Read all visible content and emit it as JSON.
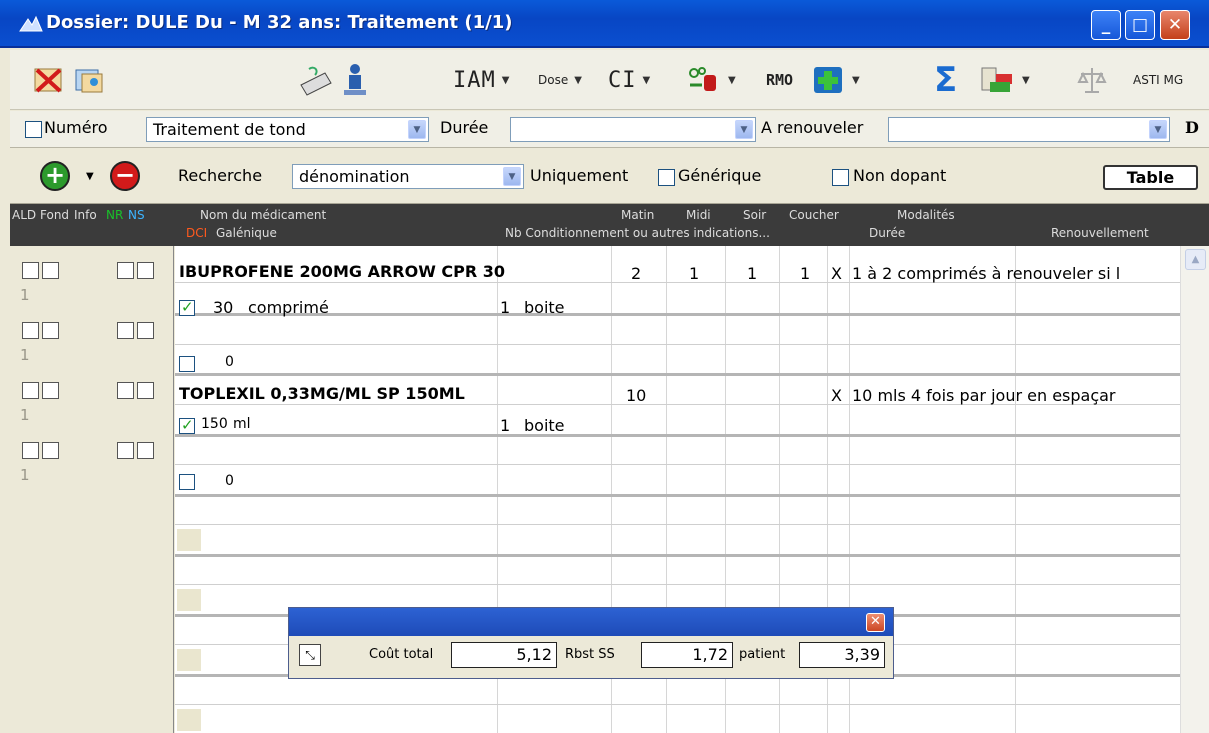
{
  "window": {
    "title": "Dossier: DULE Du - M 32 ans: Traitement  (1/1)"
  },
  "toolbar": {
    "iam_label": "IAM",
    "dose_label": "Dose",
    "ci_label": "CI",
    "rmo_label": "RMO",
    "asti_label": "ASTI MG"
  },
  "filters": {
    "numero_label": "Numéro",
    "treatment_value": "Traitement de tond",
    "duree_label": "Durée",
    "duree_value": "",
    "renouveler_label": "A renouveler",
    "renouveler_value": "",
    "d_label": "D"
  },
  "search": {
    "recherche_label": "Recherche",
    "recherche_value": "dénomination",
    "uniquement_label": "Uniquement",
    "generique_label": "Générique",
    "non_dopant_label": "Non dopant",
    "table_button": "Table"
  },
  "header": {
    "ald": "ALD",
    "fond": "Fond",
    "info": "Info",
    "nr": "NR",
    "ns": "NS",
    "nom": "Nom du médicament",
    "dci": "DCI",
    "galenique": "Galénique",
    "matin": "Matin",
    "midi": "Midi",
    "soir": "Soir",
    "coucher": "Coucher",
    "nb_cond": "Nb  Conditionnement ou autres indications...",
    "modalites": "Modalités",
    "duree": "Durée",
    "renouvellement": "Renouvellement"
  },
  "rows": [
    {
      "name": "IBUPROFENE 200MG ARROW CPR 30",
      "matin": "2",
      "midi": "1",
      "soir": "1",
      "coucher": "1",
      "x": "X",
      "modalites": "1 à 2 comprimés à renouveler si l",
      "qty": "30",
      "unit": "comprimé",
      "nb": "1",
      "cond": "boite",
      "empty_qty": "0",
      "left_num": "1"
    },
    {
      "name": "TOPLEXIL 0,33MG/ML SP 150ML",
      "matin": "10",
      "midi": "",
      "soir": "",
      "coucher": "",
      "x": "X",
      "modalites": "10 mls 4 fois par jour en espaçar",
      "qty": "150",
      "unit": "ml",
      "nb": "1",
      "cond": "boite",
      "empty_qty": "0",
      "left_num": "1"
    }
  ],
  "left_nums": [
    "1",
    "1",
    "1",
    "1"
  ],
  "cost": {
    "cout_label": "Coût total",
    "cout_value": "5,12",
    "rbst_label": "Rbst SS",
    "rbst_value": "1,72",
    "patient_label": "patient",
    "patient_value": "3,39"
  }
}
